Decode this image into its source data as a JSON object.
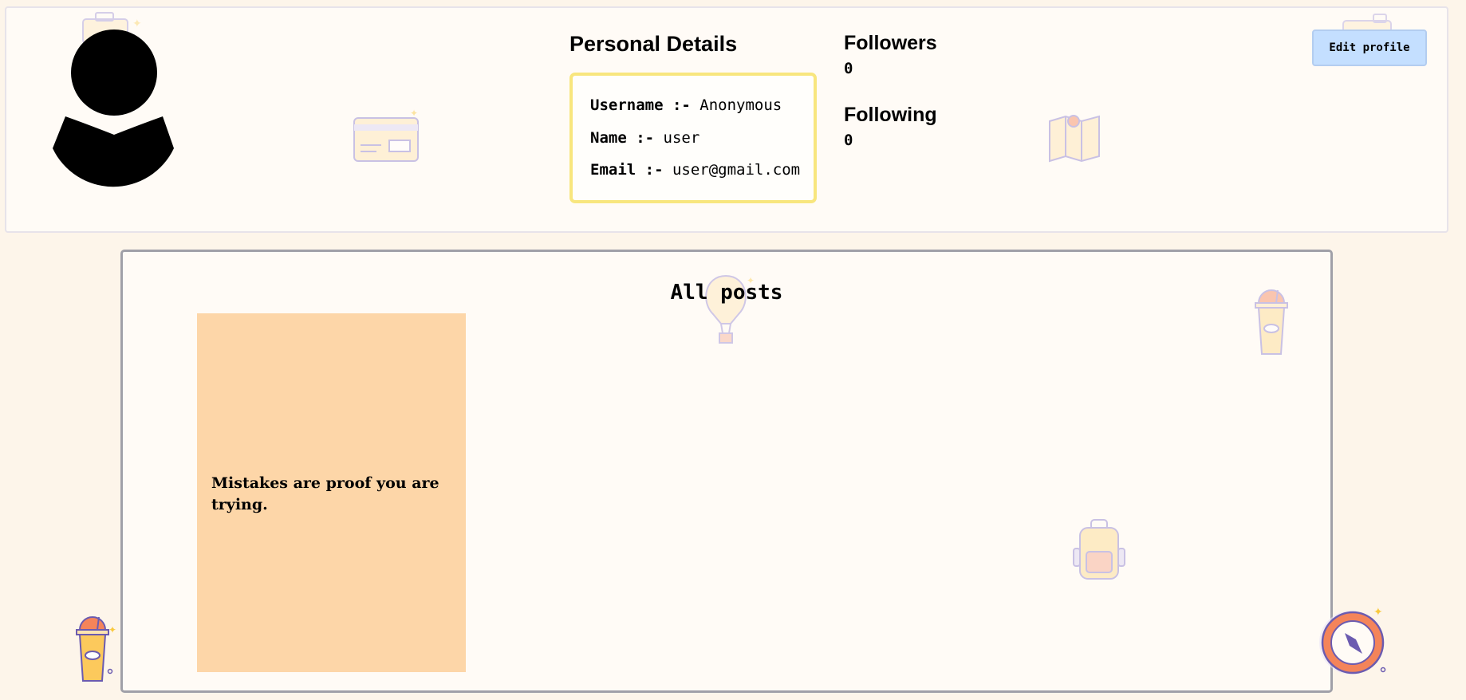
{
  "profile": {
    "personal_details_title": "Personal Details",
    "details": [
      {
        "key": "Username :-",
        "value": "Anonymous"
      },
      {
        "key": "Name :-",
        "value": "user"
      },
      {
        "key": "Email :-",
        "value": "user@gmail.com"
      }
    ],
    "followers_label": "Followers",
    "followers_count": "0",
    "following_label": "Following",
    "following_count": "0",
    "edit_button_label": "Edit profile"
  },
  "posts": {
    "title": "All posts",
    "items": [
      {
        "text": "Mistakes are proof you are trying."
      }
    ]
  },
  "colors": {
    "page_background": "#fdf5ea",
    "card_background": "#fffbf6",
    "details_border": "#f8e67e",
    "edit_button": "#c4dfff",
    "post_card": "#fdd6a8"
  },
  "icons": {
    "avatar": "user-avatar-icon",
    "decorations": [
      "suitcase-icon",
      "credit-card-icon",
      "map-icon",
      "hot-air-balloon-icon",
      "drink-cup-icon",
      "backpack-icon",
      "compass-icon"
    ]
  }
}
